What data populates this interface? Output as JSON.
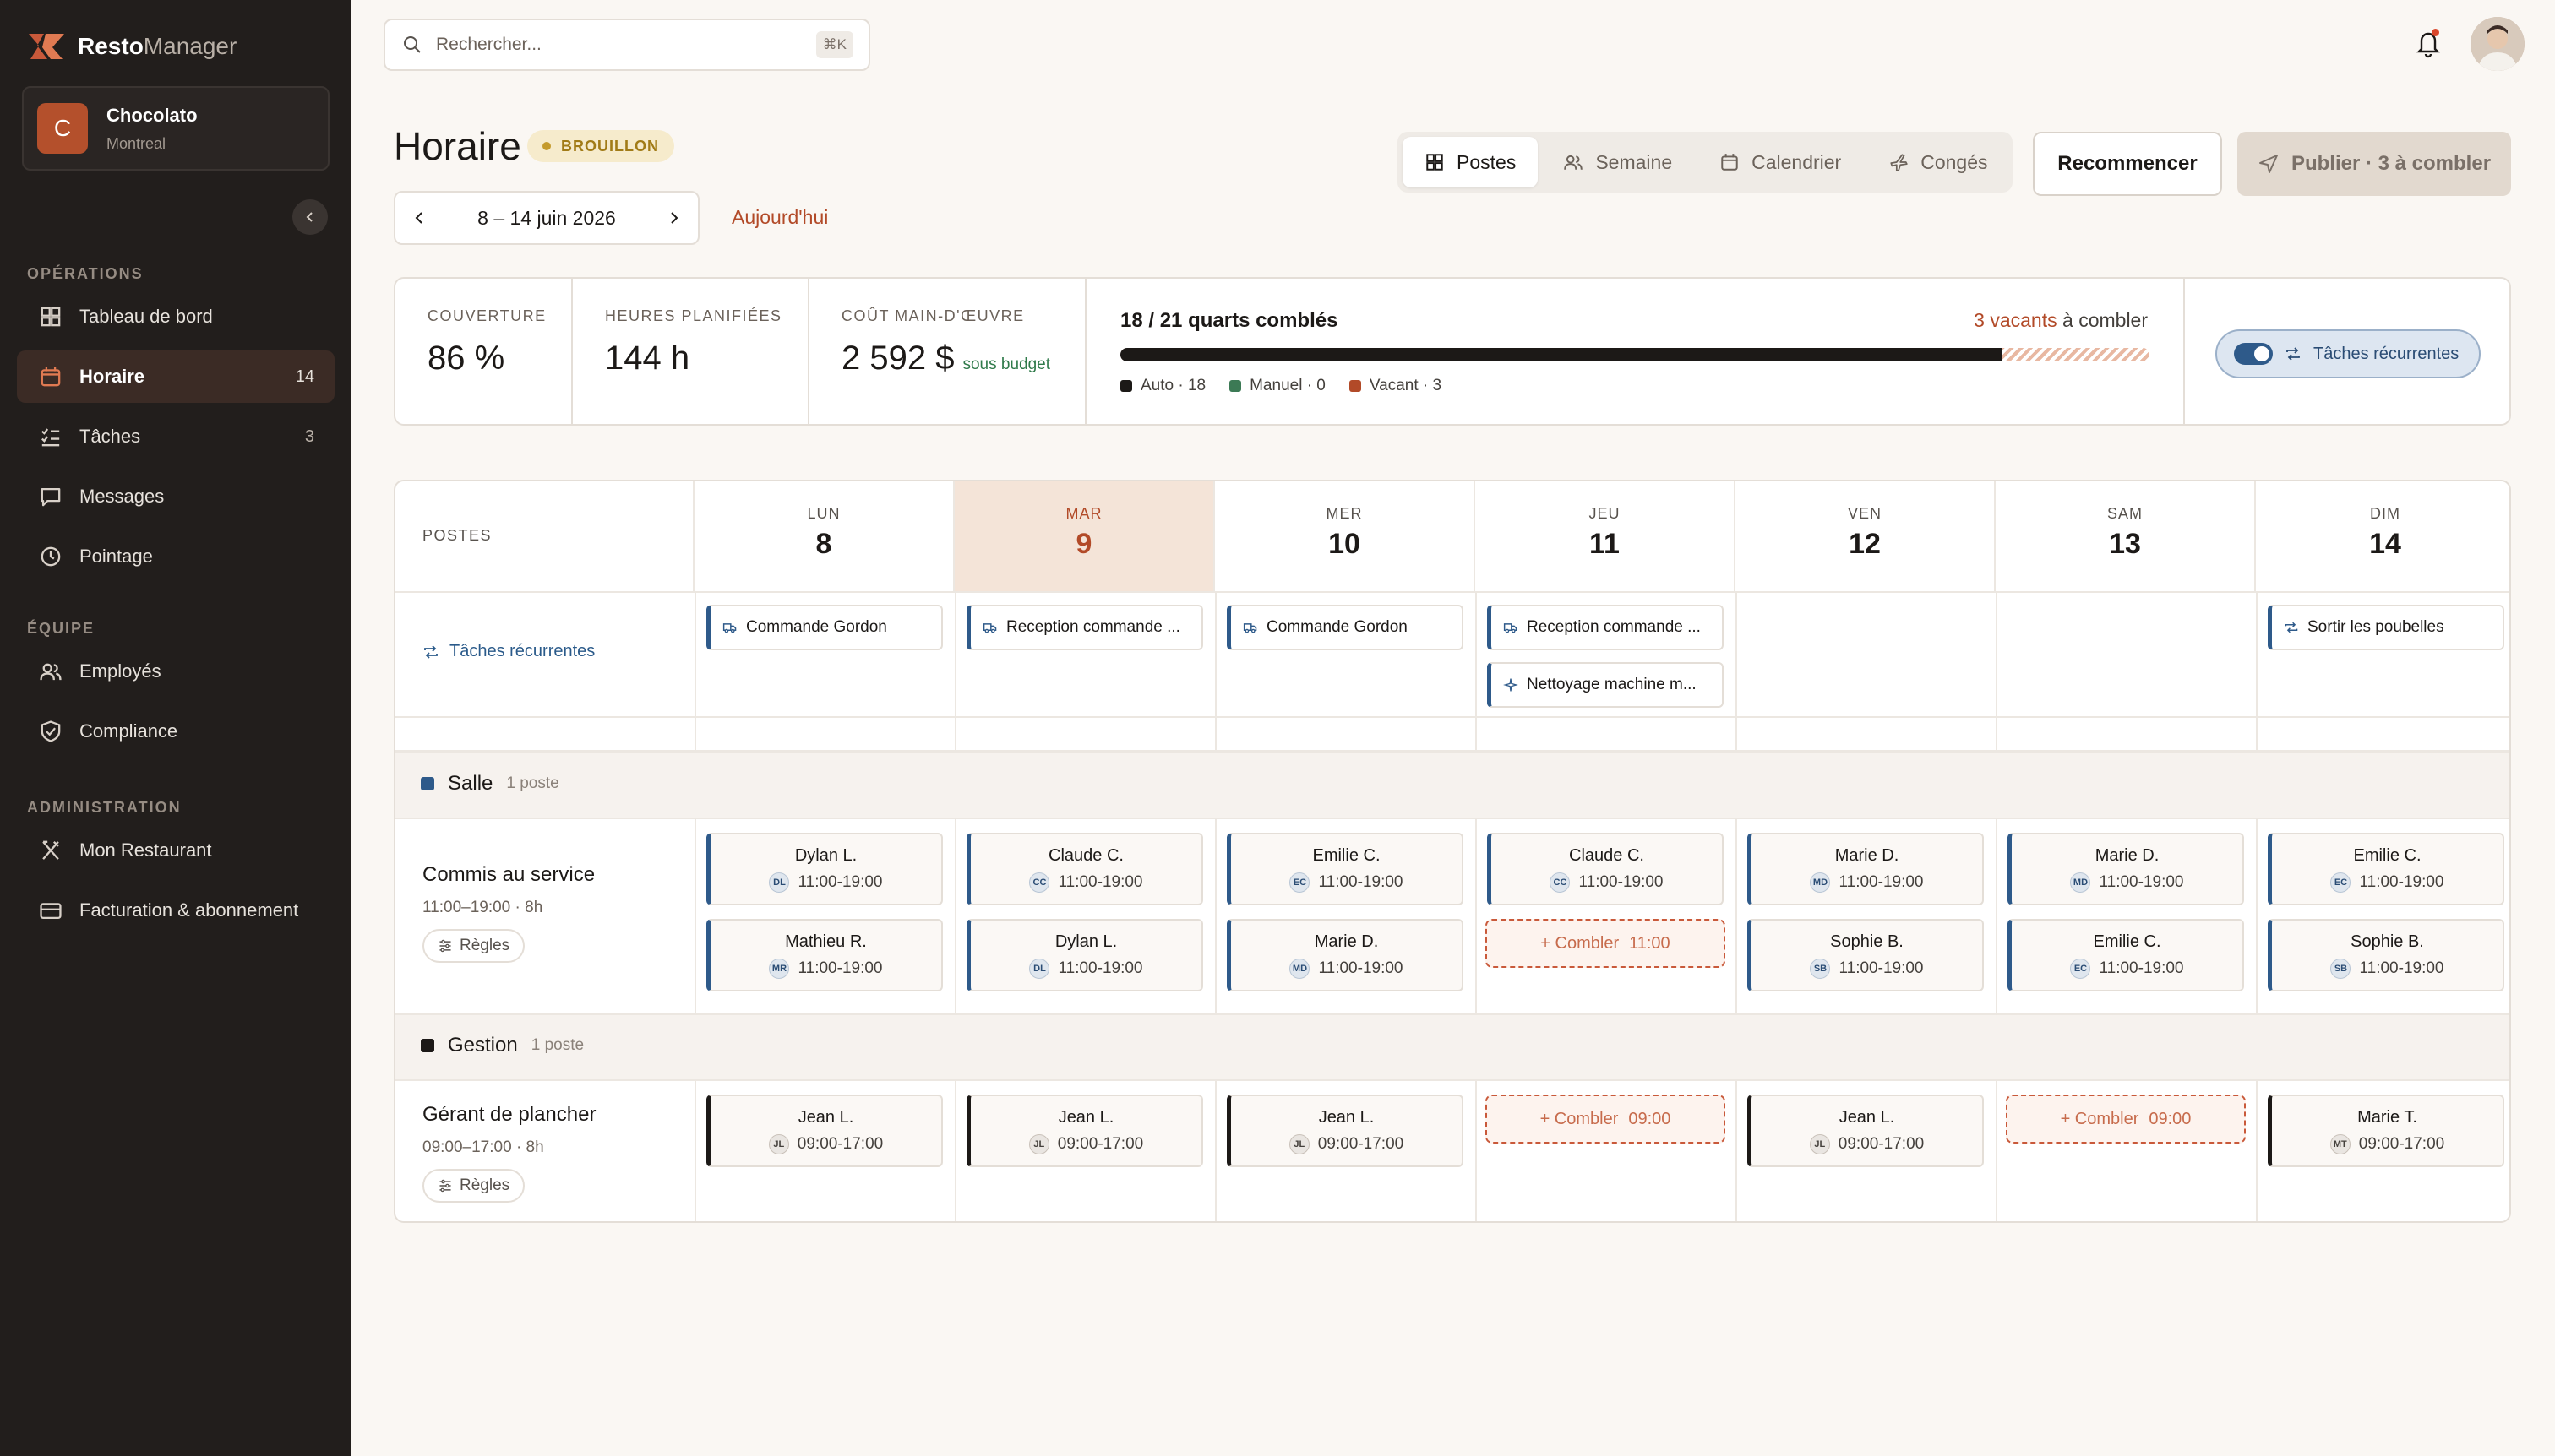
{
  "brand": {
    "name_bold": "Resto",
    "name_light": "Manager"
  },
  "restaurant": {
    "initial": "C",
    "name": "Chocolato",
    "city": "Montreal"
  },
  "search": {
    "placeholder": "Rechercher...",
    "shortcut": "⌘K"
  },
  "sidebar": {
    "sections": [
      {
        "title": "OPÉRATIONS",
        "items": [
          {
            "label": "Tableau de bord",
            "icon": "dashboard-icon",
            "count": ""
          },
          {
            "label": "Horaire",
            "icon": "calendar-icon",
            "count": "14",
            "active": true
          },
          {
            "label": "Tâches",
            "icon": "checklist-icon",
            "count": "3"
          },
          {
            "label": "Messages",
            "icon": "chat-icon",
            "count": ""
          },
          {
            "label": "Pointage",
            "icon": "clock-icon",
            "count": ""
          }
        ]
      },
      {
        "title": "ÉQUIPE",
        "items": [
          {
            "label": "Employés",
            "icon": "users-icon",
            "count": ""
          },
          {
            "label": "Compliance",
            "icon": "shield-icon",
            "count": ""
          }
        ]
      },
      {
        "title": "ADMINISTRATION",
        "items": [
          {
            "label": "Mon Restaurant",
            "icon": "utensils-icon",
            "count": ""
          },
          {
            "label": "Facturation & abonnement",
            "icon": "card-icon",
            "count": ""
          }
        ]
      }
    ]
  },
  "header": {
    "title": "Horaire",
    "status": "BROUILLON",
    "date_range": "8 – 14 juin 2026",
    "today": "Aujourd'hui",
    "views": [
      {
        "label": "Postes",
        "icon": "grid-icon",
        "active": true
      },
      {
        "label": "Semaine",
        "icon": "users-icon"
      },
      {
        "label": "Calendrier",
        "icon": "calendar-icon"
      },
      {
        "label": "Congés",
        "icon": "plane-icon"
      }
    ],
    "restart": "Recommencer",
    "publish": "Publier · 3 à combler"
  },
  "stats": {
    "coverage": {
      "label": "COUVERTURE",
      "value": "86 %"
    },
    "hours": {
      "label": "HEURES PLANIFIÉES",
      "value": "144 h"
    },
    "cost": {
      "label": "COÛT MAIN-D'ŒUVRE",
      "value": "2 592 $",
      "note": "sous budget"
    },
    "fill": {
      "title": "18 / 21 quarts comblés",
      "vacant_strong": "3 vacants",
      "vacant_rest": " à combler",
      "progress": 0.857,
      "legend": [
        {
          "label": "Auto · 18",
          "color": "#1c1917"
        },
        {
          "label": "Manuel · 0",
          "color": "#3c7a55"
        },
        {
          "label": "Vacant · 3",
          "color": "#b24a28"
        }
      ]
    },
    "recurring_toggle": "Tâches récurrentes"
  },
  "grid": {
    "postes_label": "POSTES",
    "days": [
      {
        "name": "LUN",
        "num": "8"
      },
      {
        "name": "MAR",
        "num": "9",
        "today": true
      },
      {
        "name": "MER",
        "num": "10"
      },
      {
        "name": "JEU",
        "num": "11"
      },
      {
        "name": "VEN",
        "num": "12"
      },
      {
        "name": "SAM",
        "num": "13"
      },
      {
        "name": "DIM",
        "num": "14"
      }
    ],
    "recurring": {
      "label": "Tâches récurrentes",
      "tasks": [
        {
          "day": 0,
          "label": "Commande Gordon",
          "icon": "truck-icon"
        },
        {
          "day": 1,
          "label": "Reception commande ...",
          "icon": "truck-icon"
        },
        {
          "day": 2,
          "label": "Commande Gordon",
          "icon": "truck-icon"
        },
        {
          "day": 3,
          "label": "Reception commande ...",
          "icon": "truck-icon"
        },
        {
          "day": 3,
          "label": "Nettoyage machine m...",
          "icon": "sparkle-icon",
          "slot": 1
        },
        {
          "day": 6,
          "label": "Sortir les poubelles",
          "icon": "repeat-icon"
        }
      ]
    },
    "sections": [
      {
        "name": "Salle",
        "count": "1 poste",
        "color": "#2e5a8a",
        "poste": {
          "name": "Commis au service",
          "hours": "11:00–19:00 · 8h",
          "rules": "Règles"
        },
        "shifts": [
          [
            {
              "name": "Dylan L.",
              "ini": "DL",
              "time": "11:00-19:00"
            },
            {
              "name": "Mathieu R.",
              "ini": "MR",
              "time": "11:00-19:00"
            }
          ],
          [
            {
              "name": "Claude C.",
              "ini": "CC",
              "time": "11:00-19:00"
            },
            {
              "name": "Dylan L.",
              "ini": "DL",
              "time": "11:00-19:00"
            }
          ],
          [
            {
              "name": "Emilie C.",
              "ini": "EC",
              "time": "11:00-19:00"
            },
            {
              "name": "Marie D.",
              "ini": "MD",
              "time": "11:00-19:00"
            }
          ],
          [
            {
              "name": "Claude C.",
              "ini": "CC",
              "time": "11:00-19:00"
            },
            {
              "fill": "+ Combler",
              "time": "11:00"
            }
          ],
          [
            {
              "name": "Marie D.",
              "ini": "MD",
              "time": "11:00-19:00"
            },
            {
              "name": "Sophie B.",
              "ini": "SB",
              "time": "11:00-19:00"
            }
          ],
          [
            {
              "name": "Marie D.",
              "ini": "MD",
              "time": "11:00-19:00"
            },
            {
              "name": "Emilie C.",
              "ini": "EC",
              "time": "11:00-19:00"
            }
          ],
          [
            {
              "name": "Emilie C.",
              "ini": "EC",
              "time": "11:00-19:00"
            },
            {
              "name": "Sophie B.",
              "ini": "SB",
              "time": "11:00-19:00"
            }
          ]
        ]
      },
      {
        "name": "Gestion",
        "count": "1 poste",
        "color": "#1c1917",
        "poste": {
          "name": "Gérant de plancher",
          "hours": "09:00–17:00 · 8h",
          "rules": "Règles"
        },
        "shifts": [
          [
            {
              "name": "Jean L.",
              "ini": "JL",
              "time": "09:00-17:00"
            }
          ],
          [
            {
              "name": "Jean L.",
              "ini": "JL",
              "time": "09:00-17:00"
            }
          ],
          [
            {
              "name": "Jean L.",
              "ini": "JL",
              "time": "09:00-17:00"
            }
          ],
          [
            {
              "fill": "+ Combler",
              "time": "09:00"
            }
          ],
          [
            {
              "name": "Jean L.",
              "ini": "JL",
              "time": "09:00-17:00"
            }
          ],
          [
            {
              "fill": "+ Combler",
              "time": "09:00"
            }
          ],
          [
            {
              "name": "Marie T.",
              "ini": "MT",
              "time": "09:00-17:00"
            }
          ]
        ]
      }
    ]
  }
}
